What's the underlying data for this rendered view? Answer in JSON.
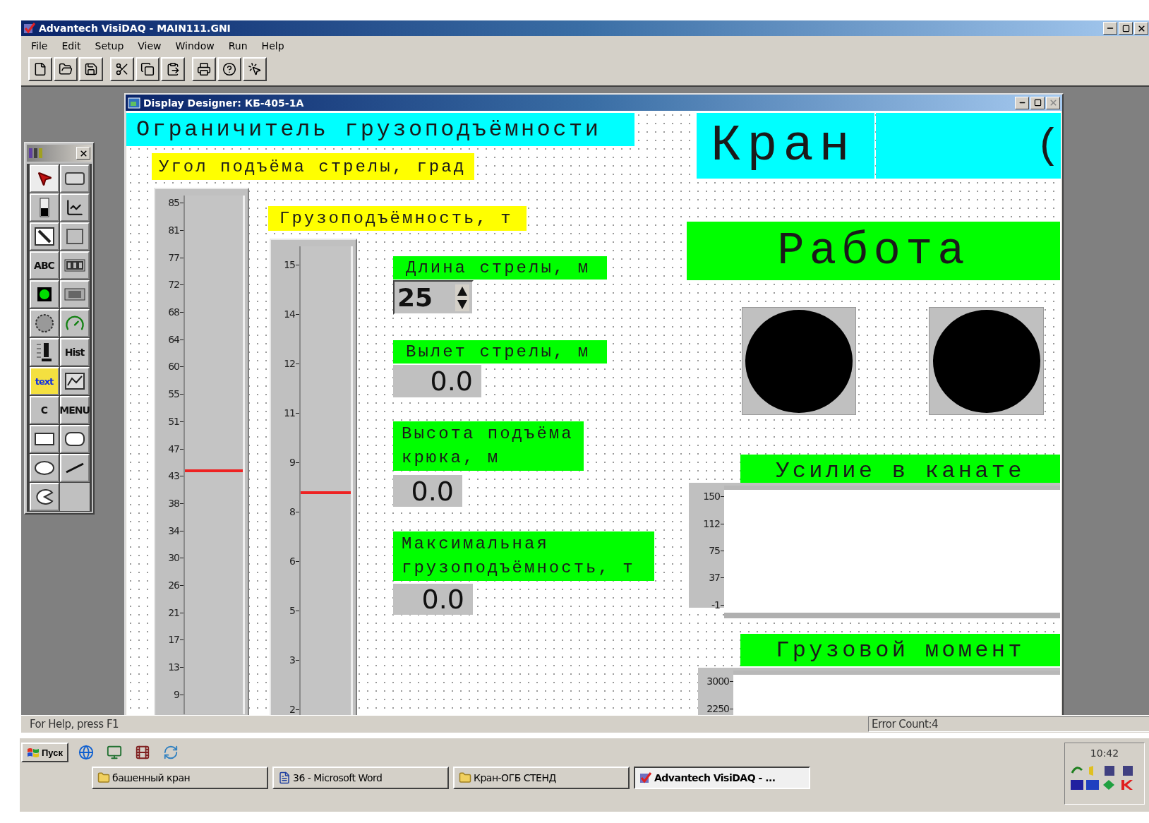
{
  "app_window": {
    "title": "Advantech VisiDAQ - MAIN111.GNI"
  },
  "menu": [
    "File",
    "Edit",
    "Setup",
    "View",
    "Window",
    "Run",
    "Help"
  ],
  "toolbar": [
    [
      {
        "kind": "new"
      },
      {
        "kind": "open"
      },
      {
        "kind": "save"
      }
    ],
    [
      {
        "kind": "cut"
      },
      {
        "kind": "copy"
      },
      {
        "kind": "paste"
      }
    ],
    [
      {
        "kind": "print"
      },
      {
        "kind": "help"
      },
      {
        "kind": "context_help"
      }
    ]
  ],
  "toolbox": {
    "tools": [
      {
        "kind": "pointer",
        "selected": true
      },
      {
        "kind": "button",
        "selected": false
      },
      {
        "kind": "switch",
        "selected": false
      },
      {
        "kind": "trend",
        "selected": false
      },
      {
        "kind": "slider",
        "selected": false
      },
      {
        "kind": "frame",
        "selected": false
      },
      {
        "kind": "text",
        "label": "ABC",
        "selected": false
      },
      {
        "kind": "numeric",
        "selected": false
      },
      {
        "kind": "lamp",
        "selected": false
      },
      {
        "kind": "display",
        "selected": false
      },
      {
        "kind": "knob",
        "selected": false
      },
      {
        "kind": "gauge",
        "selected": false
      },
      {
        "kind": "bar",
        "selected": false
      },
      {
        "kind": "text",
        "label": "Hist",
        "selected": false
      },
      {
        "kind": "multitext",
        "label": "text",
        "selected": false
      },
      {
        "kind": "graph",
        "selected": false
      },
      {
        "kind": "text",
        "label": "C",
        "selected": false
      },
      {
        "kind": "text",
        "label": "MENU",
        "selected": false
      },
      {
        "kind": "rect",
        "selected": false
      },
      {
        "kind": "roundrect",
        "selected": false
      },
      {
        "kind": "ellipse",
        "selected": false
      },
      {
        "kind": "line",
        "selected": false
      },
      {
        "kind": "pie",
        "selected": false
      }
    ]
  },
  "designer": {
    "title": "Display Designer: КБ-405-1А",
    "widgets": [
      {
        "kind": "label",
        "text": "Ограничитель грузоподъёмности",
        "color": "#00ffff"
      },
      {
        "kind": "label",
        "text": "Угол подъёма стрелы, град",
        "color": "#ffff00"
      },
      {
        "kind": "scale",
        "ticks": [
          "85",
          "81",
          "77",
          "72",
          "68",
          "64",
          "60",
          "55",
          "51",
          "47",
          "43",
          "38",
          "34",
          "30",
          "26",
          "21",
          "17",
          "13",
          "9"
        ],
        "level": 0.47
      },
      {
        "kind": "label",
        "text": "Грузоподъёмность, т",
        "color": "#ffff00"
      },
      {
        "kind": "scale",
        "ticks": [
          "15",
          "14",
          "12",
          "11",
          "9",
          "8",
          "6",
          "5",
          "3",
          "2"
        ],
        "level": 0.52
      },
      {
        "kind": "label",
        "text": "Длина стрелы, м",
        "color": "#00ff00"
      },
      {
        "kind": "spin",
        "value": "25"
      },
      {
        "kind": "label",
        "text": "Вылет стрелы, м",
        "color": "#00ff00"
      },
      {
        "kind": "value",
        "value": "0.0"
      },
      {
        "kind": "label",
        "text": "Высота подъёма крюка, м",
        "color": "#00ff00"
      },
      {
        "kind": "value",
        "value": "0.0"
      },
      {
        "kind": "label",
        "text": "Максимальная грузоподъёмность, т",
        "color": "#00ff00"
      },
      {
        "kind": "value",
        "value": "0.0"
      },
      {
        "kind": "label",
        "text": "Кран",
        "color": "#00ffff"
      },
      {
        "kind": "label",
        "text": "(",
        "color": "#00ffff"
      },
      {
        "kind": "label",
        "text": "Работа",
        "color": "#00ff00"
      },
      {
        "kind": "lamp",
        "on": false
      },
      {
        "kind": "lamp",
        "on": false
      },
      {
        "kind": "label",
        "text": "Усилие в канате",
        "color": "#00ff00"
      },
      {
        "kind": "trend",
        "ticks": [
          "150",
          "112",
          "75",
          "37",
          "-1"
        ]
      },
      {
        "kind": "label",
        "text": "Грузовой момент",
        "color": "#00ff00"
      },
      {
        "kind": "trend",
        "ticks": [
          "3000",
          "2250"
        ]
      }
    ]
  },
  "status_bar": {
    "help": "For Help, press F1",
    "errors": "Error Count:4"
  },
  "taskbar": {
    "start": "Пуск",
    "quick_launch": [
      {
        "kind": "browser"
      },
      {
        "kind": "desktop"
      },
      {
        "kind": "media"
      },
      {
        "kind": "update"
      }
    ],
    "tasks": [
      {
        "kind": "folder",
        "label": "башенный кран",
        "selected": false
      },
      {
        "kind": "document",
        "label": "36 - Microsoft Word",
        "selected": false
      },
      {
        "kind": "folder",
        "label": "Кран-ОГБ СТЕНД",
        "selected": false
      },
      {
        "kind": "app",
        "label": "Advantech VisiDAQ - ...",
        "selected": true
      }
    ],
    "clock": "10:42"
  }
}
